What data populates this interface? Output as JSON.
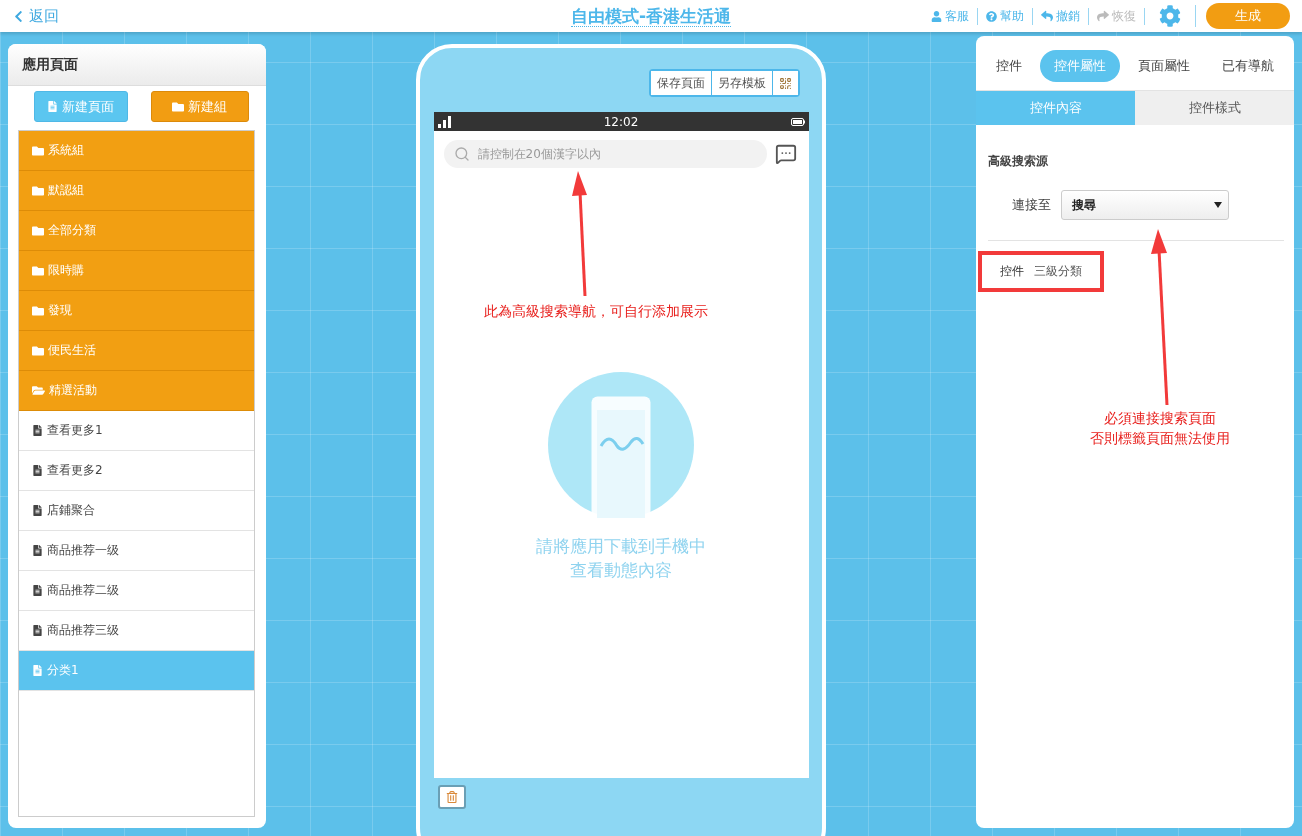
{
  "header": {
    "back": "返回",
    "title": "自由模式-香港生活通",
    "actions": [
      {
        "kind": "user",
        "label": "客服",
        "disabled": false
      },
      {
        "kind": "help",
        "label": "幫助",
        "disabled": false
      },
      {
        "kind": "undo",
        "label": "撤銷",
        "disabled": false
      },
      {
        "kind": "redo",
        "label": "恢復",
        "disabled": true
      }
    ],
    "generate": "生成"
  },
  "left_panel": {
    "title": "應用頁面",
    "buttons": [
      {
        "kind": "page",
        "label": "新建頁面"
      },
      {
        "kind": "group",
        "label": "新建組"
      }
    ],
    "items": [
      {
        "kind": "group",
        "label": "系統組",
        "expanded": false,
        "selected": false
      },
      {
        "kind": "group",
        "label": "默認組",
        "expanded": false,
        "selected": false
      },
      {
        "kind": "group",
        "label": "全部分類",
        "expanded": false,
        "selected": false
      },
      {
        "kind": "group",
        "label": "限時購",
        "expanded": false,
        "selected": false
      },
      {
        "kind": "group",
        "label": "發現",
        "expanded": false,
        "selected": false
      },
      {
        "kind": "group",
        "label": "便民生活",
        "expanded": false,
        "selected": false
      },
      {
        "kind": "group",
        "label": "精選活動",
        "expanded": true,
        "selected": false
      },
      {
        "kind": "page",
        "label": "查看更多1",
        "selected": false
      },
      {
        "kind": "page",
        "label": "查看更多2",
        "selected": false
      },
      {
        "kind": "page",
        "label": "店鋪聚合",
        "selected": false
      },
      {
        "kind": "page",
        "label": "商品推荐一级",
        "selected": false
      },
      {
        "kind": "page",
        "label": "商品推荐二级",
        "selected": false
      },
      {
        "kind": "page",
        "label": "商品推荐三级",
        "selected": false
      },
      {
        "kind": "page",
        "label": "分类1",
        "selected": true
      }
    ]
  },
  "phone": {
    "toolbar": [
      "保存頁面",
      "另存模板"
    ],
    "time": "12:02",
    "search": {
      "placeholder": "請控制在20個漢字以內"
    },
    "empty_text": [
      "請將應用下載到手機中",
      "查看動態內容"
    ]
  },
  "right_panel": {
    "tabs": [
      {
        "label": "控件",
        "selected": false
      },
      {
        "label": "控件屬性",
        "selected": true
      },
      {
        "label": "頁面屬性",
        "selected": false
      },
      {
        "label": "已有導航",
        "selected": false
      }
    ],
    "subtabs": [
      {
        "label": "控件內容",
        "selected": true
      },
      {
        "label": "控件樣式",
        "selected": false
      }
    ],
    "section_title": "高級搜索源",
    "link_label": "連接至",
    "link_value": "搜尋",
    "control": {
      "label": "控件",
      "value": "三級分類",
      "highlighted": true
    }
  },
  "annotations": [
    {
      "kind": "phone",
      "lines": [
        "此為高級搜索導航，可自行添加展示"
      ]
    },
    {
      "kind": "panel",
      "lines": [
        "必須連接搜索頁面",
        "否則標籤頁面無法使用"
      ]
    }
  ]
}
